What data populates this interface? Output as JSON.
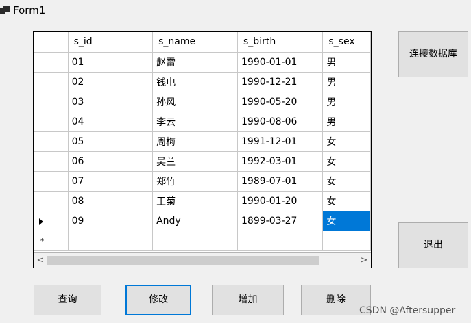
{
  "window": {
    "title": "Form1",
    "minimize_glyph": "–"
  },
  "grid": {
    "columns": [
      "s_id",
      "s_name",
      "s_birth",
      "s_sex"
    ],
    "rows": [
      [
        "01",
        "赵雷",
        "1990-01-01",
        "男"
      ],
      [
        "02",
        "钱电",
        "1990-12-21",
        "男"
      ],
      [
        "03",
        "孙风",
        "1990-05-20",
        "男"
      ],
      [
        "04",
        "李云",
        "1990-08-06",
        "男"
      ],
      [
        "05",
        "周梅",
        "1991-12-01",
        "女"
      ],
      [
        "06",
        "吴兰",
        "1992-03-01",
        "女"
      ],
      [
        "07",
        "郑竹",
        "1989-07-01",
        "女"
      ],
      [
        "08",
        "王菊",
        "1990-01-20",
        "女"
      ],
      [
        "09",
        "Andy",
        "1899-03-27",
        "女"
      ]
    ],
    "current_row_marker": "▶",
    "new_row_marker": "*",
    "selected_cell": {
      "row": 9,
      "column": "s_sex"
    },
    "scroll_left_glyph": "<",
    "scroll_right_glyph": ">"
  },
  "buttons": {
    "connect": "连接数据库",
    "exit": "退出",
    "query": "查询",
    "modify": "修改",
    "add": "增加",
    "delete": "删除"
  },
  "watermark": "CSDN @Aftersupper",
  "colors": {
    "selection": "#0078d7",
    "focus_border": "#0078d7",
    "window_bg": "#f0f0f0"
  }
}
